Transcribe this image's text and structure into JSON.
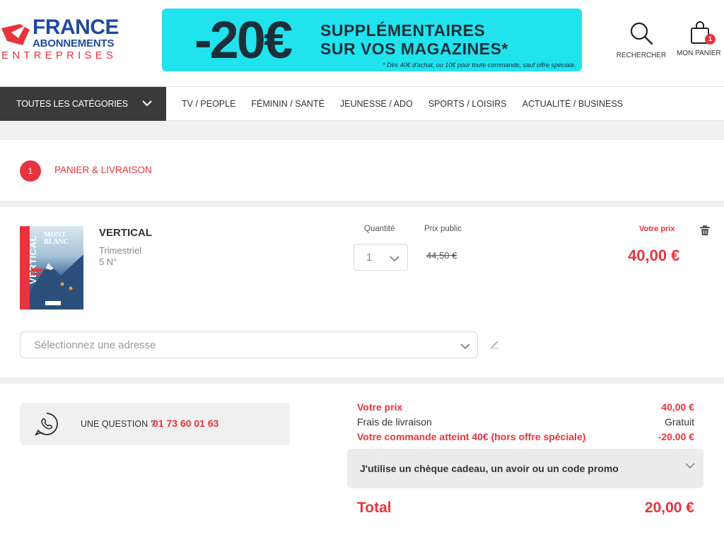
{
  "brand": {
    "line1": "FRANCE",
    "line2": "ABONNEMENTS",
    "line3": "ENTREPRISES",
    "colors": {
      "blue": "#1e4a9c",
      "red": "#e8343c"
    }
  },
  "banner": {
    "big": "-20€",
    "line1": "SUPPLÉMENTAIRES",
    "line2": "SUR VOS MAGAZINES*",
    "note": "* Dès 40€ d'achat, ou 10€ pour toute commande, sauf offre spéciale.",
    "color": "#20e3ee"
  },
  "header_actions": {
    "search_label": "RECHERCHER",
    "cart_label": "MON PANIER",
    "cart_count": "1"
  },
  "nav": {
    "all_categories": "TOUTES LES CATÉGORIES",
    "links": [
      "TV / PEOPLE",
      "FÉMININ / SANTÉ",
      "JEUNESSE / ADO",
      "SPORTS / LOISIRS",
      "ACTUALITÉ / BUSINESS"
    ]
  },
  "step": {
    "number": "1",
    "label": "PANIER & LIVRAISON"
  },
  "product": {
    "name": "VERTICAL",
    "frequency": "Trimestriel",
    "issues": "5 N°",
    "cover_title_l1": "MONT",
    "cover_title_l2": "BLANC",
    "cover_brand": "VERTICAL",
    "quantity_header": "Quantité",
    "quantity_value": "1",
    "public_price_header": "Prix public",
    "public_price": "44,50 €",
    "your_price_header": "Votre prix",
    "your_price": "40,00 €"
  },
  "address": {
    "placeholder": "Sélectionnez une adresse"
  },
  "help": {
    "text": "UNE QUESTION ?",
    "phone": "01 73 60 01 63"
  },
  "summary": {
    "rows": [
      {
        "label": "Votre prix",
        "value": "40,00 €"
      },
      {
        "label": "Frais de livraison",
        "value": "Gratuit"
      },
      {
        "label": "Votre commande atteint 40€ (hors offre spéciale)",
        "value": "-20.00 €"
      }
    ],
    "promo_label": "J'utilise un chèque cadeau, un avoir ou un code promo",
    "total_label": "Total",
    "total_value": "20,00 €"
  }
}
